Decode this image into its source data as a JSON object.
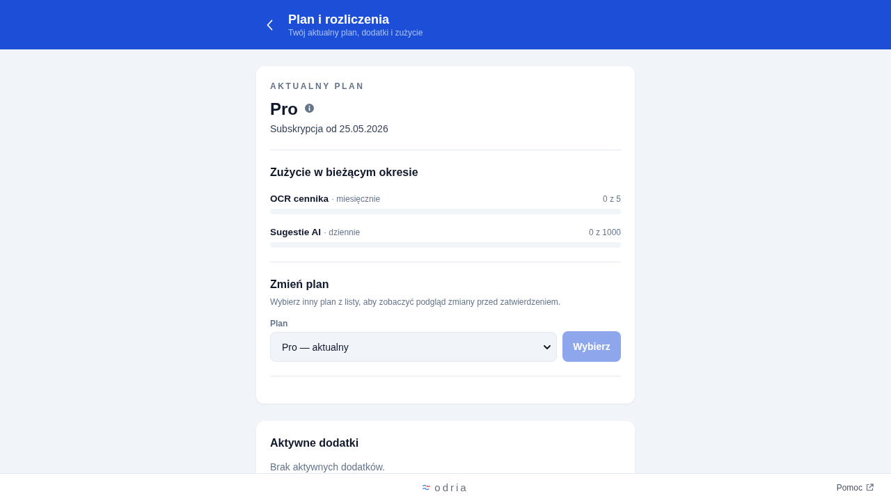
{
  "header": {
    "title": "Plan i rozliczenia",
    "subtitle": "Twój aktualny plan, dodatki i zużycie"
  },
  "current_plan": {
    "label": "AKTUALNY PLAN",
    "name": "Pro",
    "subscription": "Subskrypcja od 25.05.2026"
  },
  "usage": {
    "title": "Zużycie w bieżącym okresie",
    "items": [
      {
        "name": "OCR cennika",
        "period": "· miesięcznie",
        "count": "0 z 5",
        "level": 0
      },
      {
        "name": "Sugestie AI",
        "period": "· dziennie",
        "count": "0 z 1000",
        "level": 0
      }
    ]
  },
  "change_plan": {
    "title": "Zmień plan",
    "description": "Wybierz inny plan z listy, aby zobaczyć podgląd zmiany przed zatwierdzeniem.",
    "field_label": "Plan",
    "select_value": "Pro — aktualny",
    "button": {
      "label": "Wybierz",
      "disabled": true
    }
  },
  "addons": {
    "title": "Aktywne dodatki",
    "empty_text": "Brak aktywnych dodatków."
  },
  "footer": {
    "logo_text": "odria",
    "help_link": "Pomoc"
  }
}
